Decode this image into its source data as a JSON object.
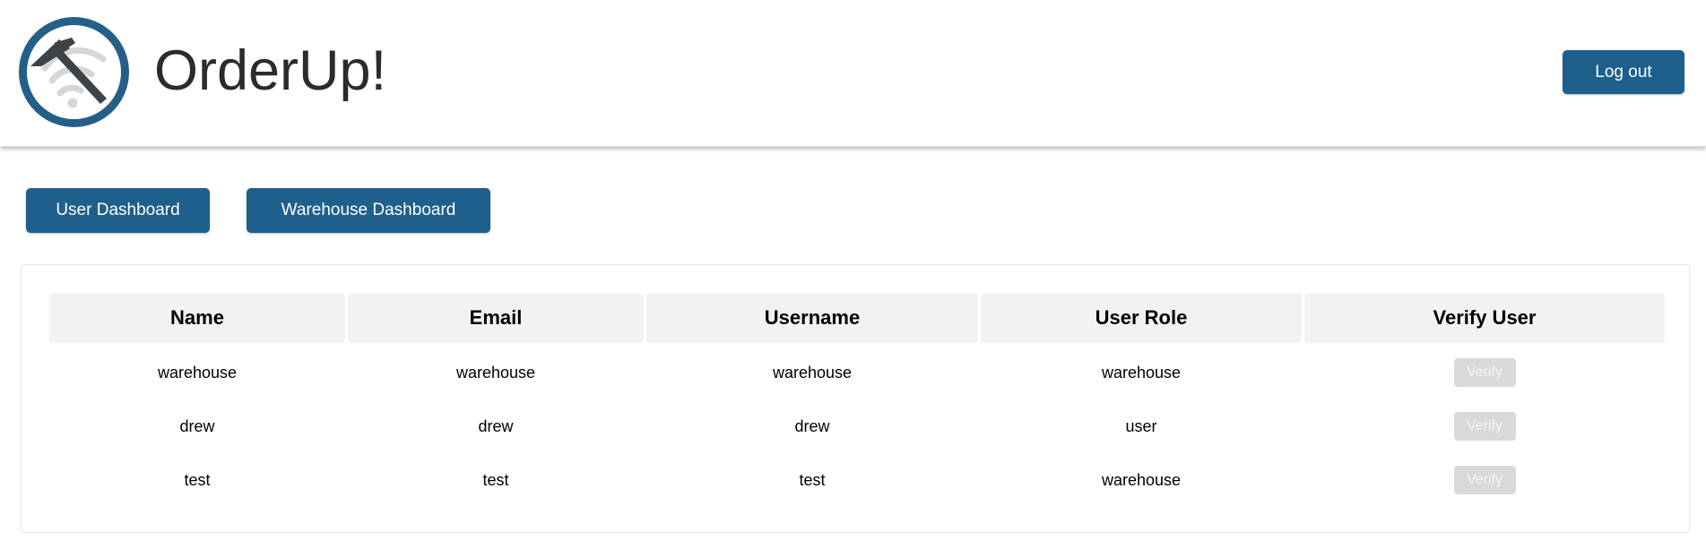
{
  "app": {
    "title": "OrderUp!",
    "logo_icon": "hammer-wifi-logo-icon",
    "accent_color": "#1f5f8b"
  },
  "header": {
    "logout_label": "Log out"
  },
  "nav": {
    "user_dashboard_label": "User Dashboard",
    "warehouse_dashboard_label": "Warehouse Dashboard"
  },
  "table": {
    "columns": [
      "Name",
      "Email",
      "Username",
      "User Role",
      "Verify User"
    ],
    "rows": [
      {
        "name": "warehouse",
        "email": "warehouse",
        "username": "warehouse",
        "role": "warehouse",
        "action": "Verify"
      },
      {
        "name": "drew",
        "email": "drew",
        "username": "drew",
        "role": "user",
        "action": "Verify"
      },
      {
        "name": "test",
        "email": "test",
        "username": "test",
        "role": "warehouse",
        "action": "Verify"
      }
    ]
  }
}
